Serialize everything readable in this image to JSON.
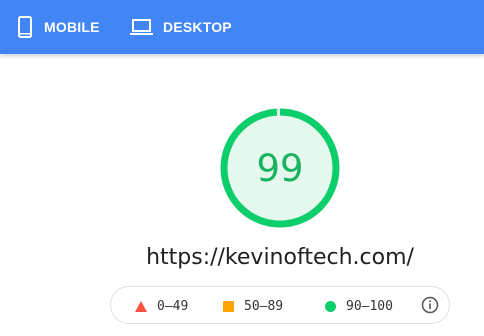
{
  "tabs": [
    {
      "label": "MOBILE",
      "icon": "phone-icon"
    },
    {
      "label": "DESKTOP",
      "icon": "laptop-icon"
    }
  ],
  "report": {
    "score": "99",
    "score_fraction": 0.99,
    "url": "https://kevinoftech.com/"
  },
  "legend": {
    "fail": "0–49",
    "average": "50–89",
    "pass": "90–100",
    "info_icon": "info-icon"
  },
  "colors": {
    "header": "#4285f4",
    "pass": "#0cce6b",
    "pass_fill": "#e5f8ee",
    "average": "#ffa400",
    "fail": "#ff4e42"
  }
}
